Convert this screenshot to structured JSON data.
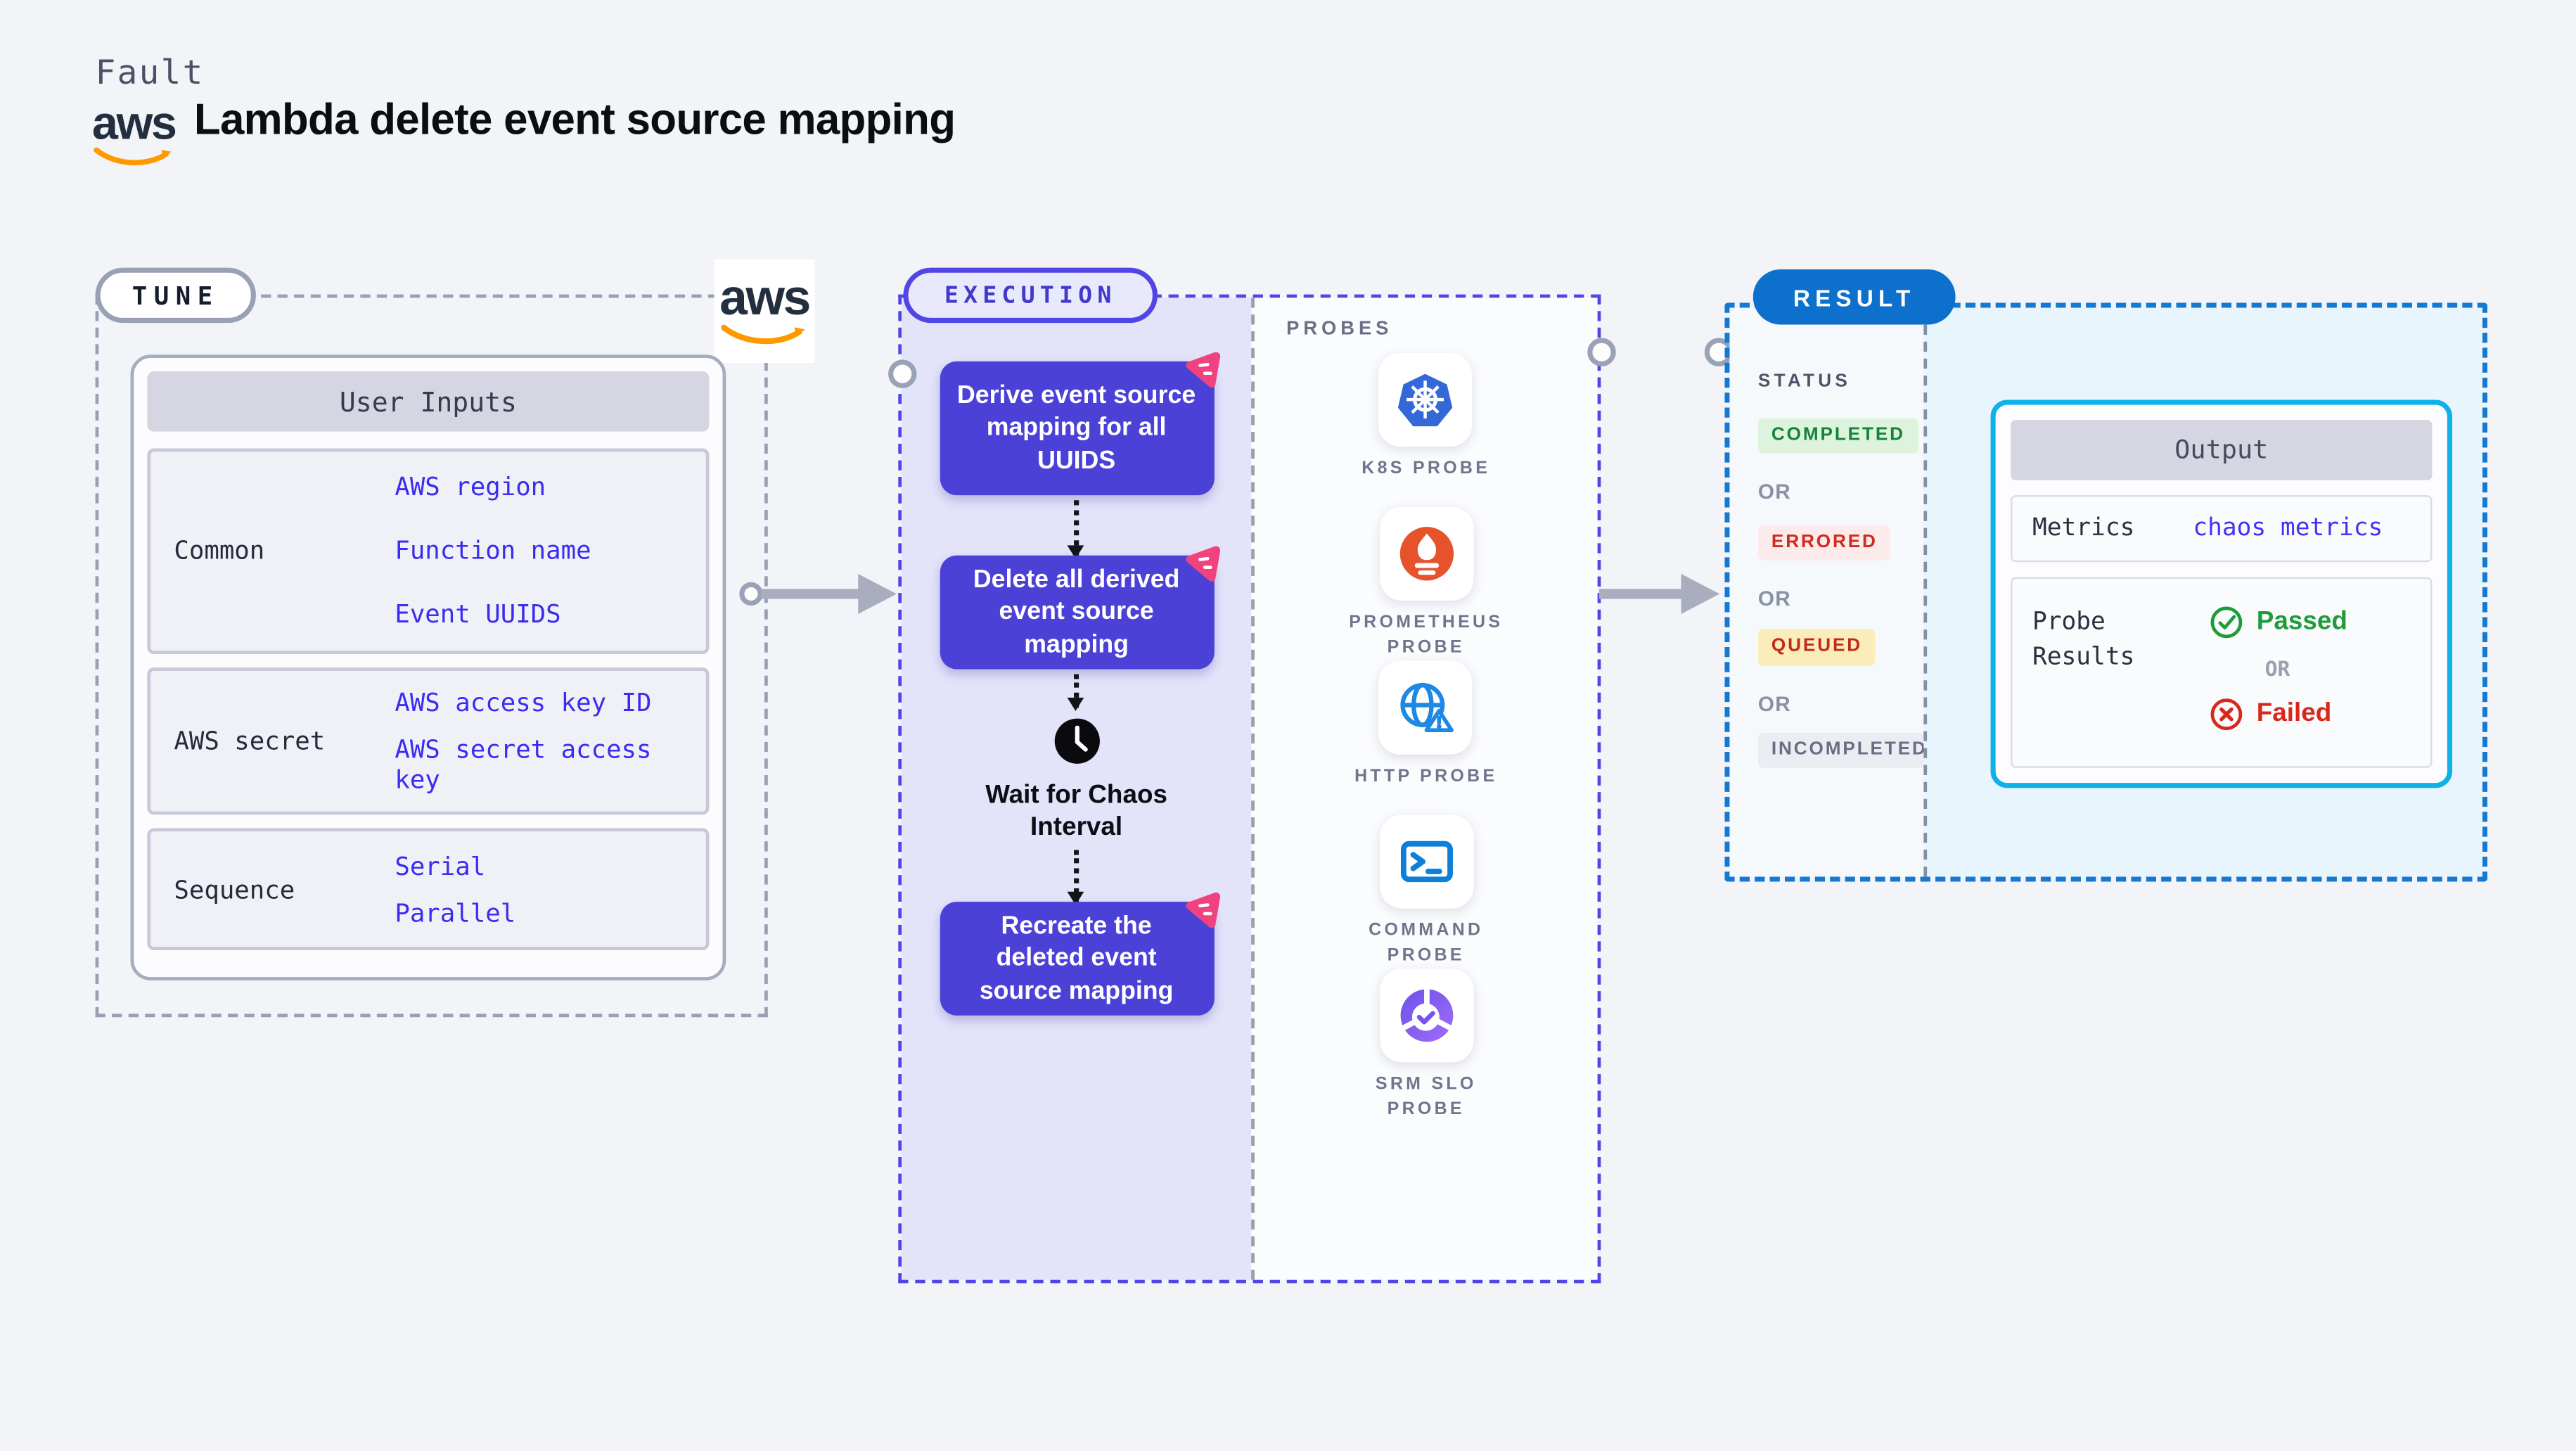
{
  "header": {
    "fault_label": "Fault",
    "title": "Lambda delete event source mapping",
    "aws_logo_text": "aws"
  },
  "tune": {
    "label": "TUNE",
    "card_title": "User Inputs",
    "rows": [
      {
        "label": "Common",
        "values": [
          "AWS region",
          "Function name",
          "Event UUIDS"
        ]
      },
      {
        "label": "AWS secret",
        "values": [
          "AWS access key ID",
          "AWS secret access key"
        ]
      },
      {
        "label": "Sequence",
        "values": [
          "Serial",
          "Parallel"
        ]
      }
    ]
  },
  "execution": {
    "label": "EXECUTION",
    "steps": [
      "Derive event source mapping for all UUIDS",
      "Delete all derived event source mapping",
      "Wait for Chaos Interval",
      "Recreate the deleted event source mapping"
    ]
  },
  "probes": {
    "label": "PROBES",
    "items": [
      {
        "name": "K8S PROBE",
        "icon": "kubernetes-icon"
      },
      {
        "name": "PROMETHEUS\nPROBE",
        "icon": "prometheus-icon"
      },
      {
        "name": "HTTP PROBE",
        "icon": "http-globe-icon"
      },
      {
        "name": "COMMAND\nPROBE",
        "icon": "command-terminal-icon"
      },
      {
        "name": "SRM SLO\nPROBE",
        "icon": "srm-slo-icon"
      }
    ]
  },
  "result": {
    "label": "RESULT",
    "status_label": "STATUS",
    "or_label": "OR",
    "statuses": [
      {
        "text": "COMPLETED",
        "fg": "#15833c",
        "bg": "#def3dd"
      },
      {
        "text": "ERRORED",
        "fg": "#cf2b20",
        "bg": "#fcebea"
      },
      {
        "text": "QUEUED",
        "fg": "#c12a18",
        "bg": "#faecbb"
      },
      {
        "text": "INCOMPLETED",
        "fg": "#676d83",
        "bg": "#ececf3"
      }
    ],
    "output": {
      "title": "Output",
      "metrics_label": "Metrics",
      "metrics_value": "chaos metrics",
      "probe_results_label": "Probe Results",
      "passed_label": "Passed",
      "or_label": "OR",
      "failed_label": "Failed"
    }
  },
  "colors": {
    "page_bg": "#f2f4f8",
    "tune_dash": "#98a0b3",
    "execution_dash": "#4f46e5",
    "execution_fill": "#e3e3fa",
    "step_box": "#4c41d6",
    "chaos_pink": "#f0427f",
    "link_blue": "#3a2cf0",
    "result_dash": "#1379d4",
    "result_pill": "#0d70cc",
    "output_border": "#0fb1e8",
    "passed_green": "#1e9c3a",
    "failed_red": "#d8281c",
    "prometheus_orange": "#e6522c",
    "k8s_blue": "#3468d8",
    "aws_orange": "#ff9900"
  }
}
